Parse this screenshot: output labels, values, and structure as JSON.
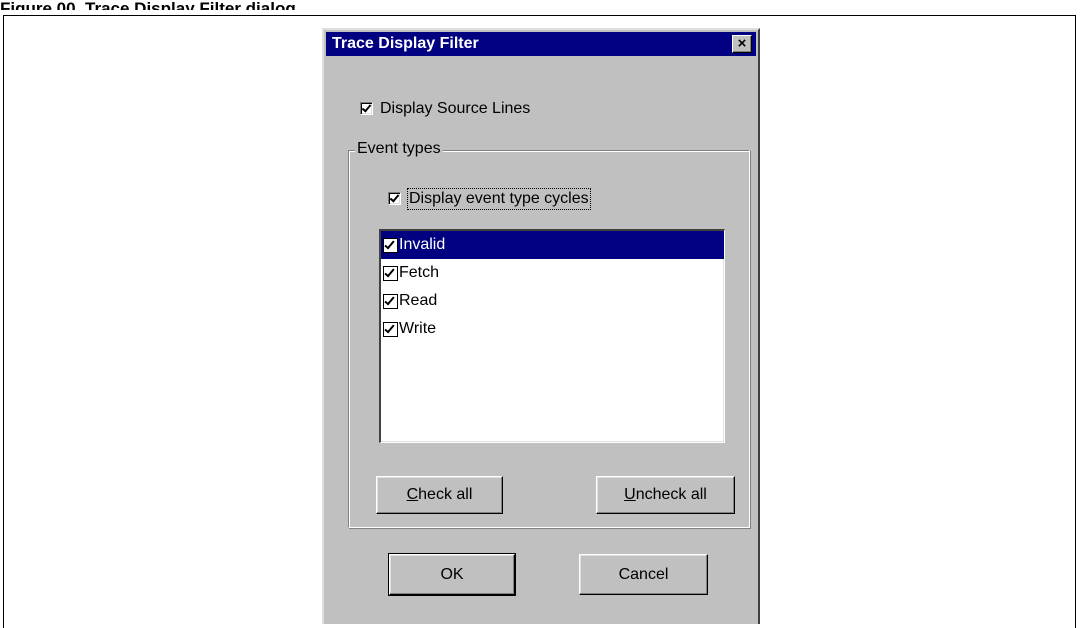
{
  "figure": {
    "caption": "Figure 00. Trace Display Filter dialog"
  },
  "dialog": {
    "title": "Trace Display Filter",
    "close_label": "×",
    "display_source_lines": {
      "label": "Display Source Lines",
      "checked": true
    },
    "event_types": {
      "legend": "Event types",
      "display_cycles": {
        "label": "Display event type cycles",
        "checked": true
      },
      "items": [
        {
          "label": "Invalid",
          "checked": true,
          "selected": true
        },
        {
          "label": "Fetch",
          "checked": true,
          "selected": false
        },
        {
          "label": "Read",
          "checked": true,
          "selected": false
        },
        {
          "label": "Write",
          "checked": true,
          "selected": false
        }
      ],
      "check_all_access": "C",
      "check_all_rest": "heck all",
      "uncheck_all_access": "U",
      "uncheck_all_rest": "ncheck all"
    },
    "ok_label": "OK",
    "cancel_label": "Cancel"
  },
  "colors": {
    "title_bar": "#000080",
    "dialog_face": "#c0c0c0",
    "selection": "#000080"
  }
}
